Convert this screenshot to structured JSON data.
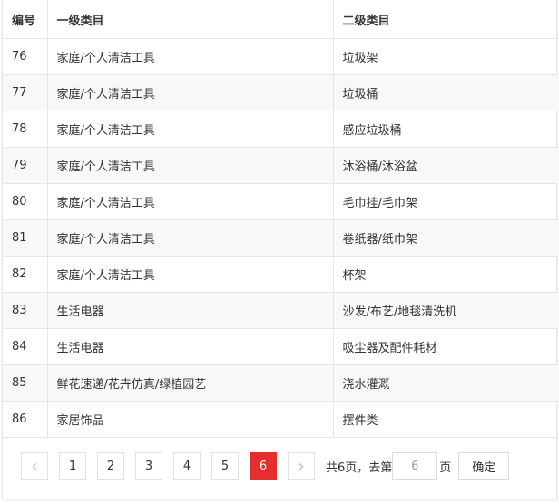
{
  "table": {
    "headers": [
      "编号",
      "一级类目",
      "二级类目"
    ],
    "rows": [
      [
        "76",
        "家庭/个人清洁工具",
        "垃圾架"
      ],
      [
        "77",
        "家庭/个人清洁工具",
        "垃圾桶"
      ],
      [
        "78",
        "家庭/个人清洁工具",
        "感应垃圾桶"
      ],
      [
        "79",
        "家庭/个人清洁工具",
        "沐浴桶/沐浴盆"
      ],
      [
        "80",
        "家庭/个人清洁工具",
        "毛巾挂/毛巾架"
      ],
      [
        "81",
        "家庭/个人清洁工具",
        "卷纸器/纸巾架"
      ],
      [
        "82",
        "家庭/个人清洁工具",
        "杯架"
      ],
      [
        "83",
        "生活电器",
        "沙发/布艺/地毯清洗机"
      ],
      [
        "84",
        "生活电器",
        "吸尘器及配件耗材"
      ],
      [
        "85",
        "鲜花速递/花卉仿真/绿植园艺",
        "浇水灌溉"
      ],
      [
        "86",
        "家居饰品",
        "摆件类"
      ]
    ]
  },
  "pagination": {
    "prev_icon": "chevron-left-icon",
    "next_icon": "chevron-right-icon",
    "pages": [
      "1",
      "2",
      "3",
      "4",
      "5",
      "6"
    ],
    "current": "6",
    "total_text": "共6页，去第",
    "input_value": "6",
    "suffix": "页",
    "confirm_label": "确定",
    "active_color": "#e52e2e"
  }
}
